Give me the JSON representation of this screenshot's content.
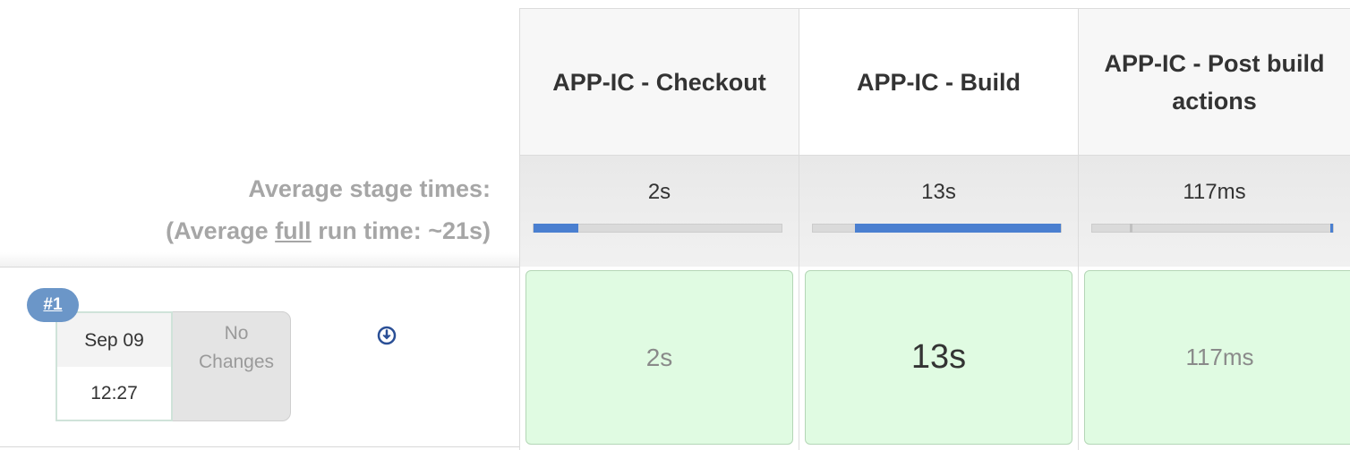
{
  "summary": {
    "avg_stage_label": "Average stage times:",
    "avg_full_prefix": "(Average ",
    "avg_full_word": "full",
    "avg_full_suffix": " run time: ~21s)"
  },
  "stages": [
    {
      "name": "APP-IC - Checkout",
      "avg_time": "2s",
      "avg_progress_fraction": 0.18
    },
    {
      "name": "APP-IC - Build",
      "avg_time": "13s",
      "avg_progress_fraction": 0.83
    },
    {
      "name": "APP-IC - Post build actions",
      "avg_time": "117ms",
      "avg_progress_fraction": 0.01
    }
  ],
  "runs": [
    {
      "id_label": "#1",
      "date": "Sep 09",
      "time": "12:27",
      "changes_line1": "No",
      "changes_line2": "Changes",
      "durations": [
        "2s",
        "13s",
        "117ms"
      ]
    }
  ],
  "colors": {
    "success_cell": "#e0fbe2",
    "progress_fill": "#4a7fd0",
    "badge": "#6b96c8"
  },
  "icons": {
    "download": "download-circle-icon"
  }
}
